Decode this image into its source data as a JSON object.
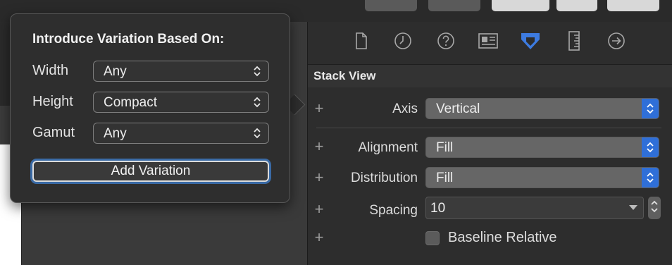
{
  "popover": {
    "title": "Introduce Variation Based On:",
    "rows": [
      {
        "label": "Width",
        "value": "Any"
      },
      {
        "label": "Height",
        "value": "Compact"
      },
      {
        "label": "Gamut",
        "value": "Any"
      }
    ],
    "add_button": "Add Variation"
  },
  "inspector": {
    "tabs": [
      {
        "icon": "file-icon",
        "selected": false
      },
      {
        "icon": "clock-icon",
        "selected": false
      },
      {
        "icon": "help-icon",
        "selected": false
      },
      {
        "icon": "identity-card-icon",
        "selected": false
      },
      {
        "icon": "attributes-icon",
        "selected": true
      },
      {
        "icon": "ruler-icon",
        "selected": false
      },
      {
        "icon": "connections-arrow-icon",
        "selected": false
      }
    ],
    "section_title": "Stack View",
    "axis": {
      "label": "Axis",
      "value": "Vertical"
    },
    "alignment": {
      "label": "Alignment",
      "value": "Fill"
    },
    "distribution": {
      "label": "Distribution",
      "value": "Fill"
    },
    "spacing": {
      "label": "Spacing",
      "value": "10"
    },
    "baseline": {
      "label": "Baseline Relative",
      "checked": false
    },
    "plus_symbol": "+"
  },
  "colors": {
    "accent_blue": "#2f6fd8",
    "selected_tab": "#3d7be0",
    "background": "#2b2b2b"
  }
}
